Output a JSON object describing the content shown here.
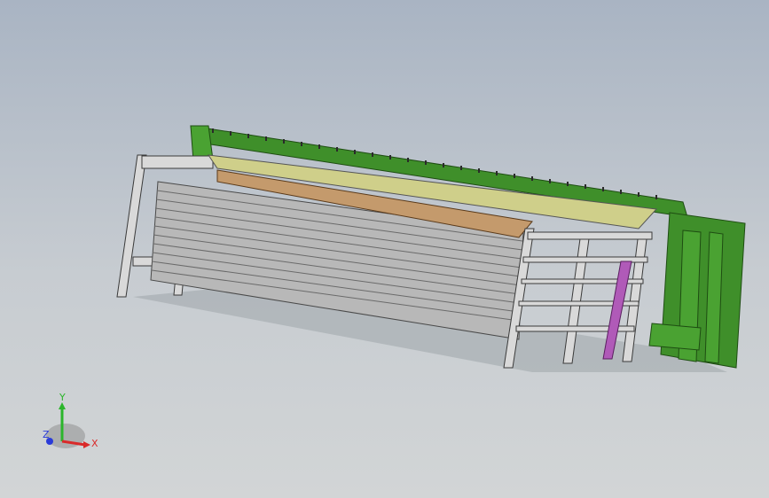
{
  "viewport": {
    "background_top": "#a9b4c3",
    "background_bottom": "#d2d5d6"
  },
  "model": {
    "frame_color": "#d9d9d9",
    "panel_color": "#b8b8b8",
    "green_color": "#3f8f2a",
    "tabletop_color": "#cfcf8a",
    "wood_color": "#c49a6c",
    "purple_color": "#b05ab8"
  },
  "triad": {
    "x_label": "X",
    "y_label": "Y",
    "z_label": "Z",
    "x_color": "#d92a2a",
    "y_color": "#2bb52b",
    "z_color": "#2a3bd9"
  }
}
